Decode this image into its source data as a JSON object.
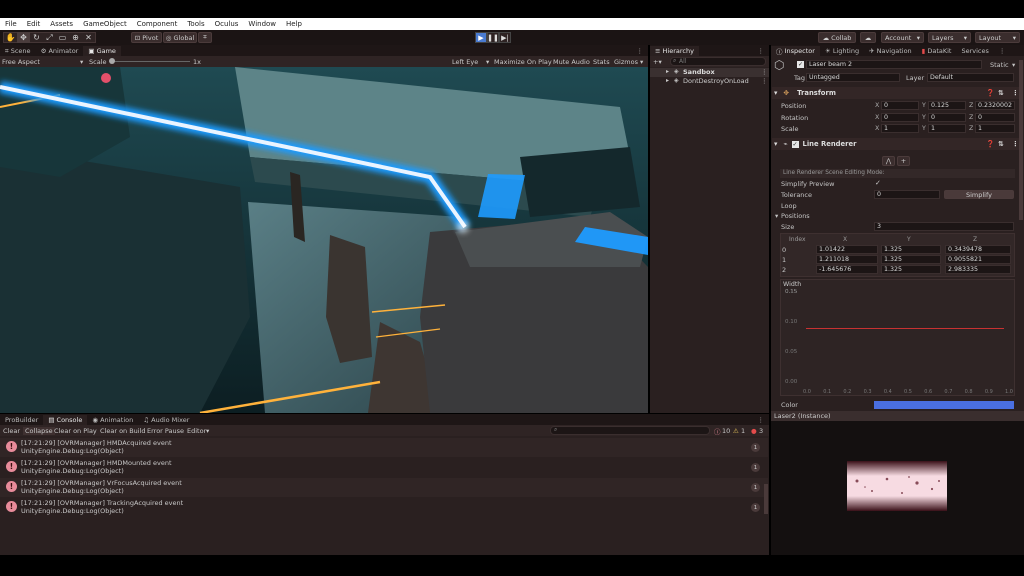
{
  "menu": [
    "File",
    "Edit",
    "Assets",
    "GameObject",
    "Component",
    "Tools",
    "Oculus",
    "Window",
    "Help"
  ],
  "toolbar": {
    "pivot": "Pivot",
    "global": "Global",
    "collab": "Collab",
    "account": "Account",
    "layers": "Layers",
    "layout": "Layout",
    "play_icon": "play-icon",
    "pause_icon": "pause-icon",
    "step_icon": "step-icon"
  },
  "scene_tabs": [
    "Scene",
    "Animator",
    "Game"
  ],
  "game_bar": {
    "aspect": "Free Aspect",
    "scale_label": "Scale",
    "scale_value": "1x",
    "eye": "Left Eye",
    "maximize": "Maximize On Play",
    "mute": "Mute Audio",
    "stats": "Stats",
    "gizmos": "Gizmos"
  },
  "hierarchy": {
    "tab": "Hierarchy",
    "search_placeholder": "All",
    "items": [
      "Sandbox",
      "DontDestroyOnLoad"
    ]
  },
  "inspector_tabs": [
    "Inspector",
    "Lighting",
    "Navigation",
    "DataKit",
    "Services"
  ],
  "inspector": {
    "object_name": "Laser beam 2",
    "static": "Static",
    "tag_label": "Tag",
    "tag": "Untagged",
    "layer_label": "Layer",
    "layer": "Default",
    "transform": {
      "title": "Transform",
      "position_label": "Position",
      "rotation_label": "Rotation",
      "scale_label": "Scale",
      "position": [
        "0",
        "0.125",
        "0.2320002"
      ],
      "rotation": [
        "0",
        "0",
        "0"
      ],
      "scale": [
        "1",
        "1",
        "1"
      ]
    },
    "line_renderer": {
      "title": "Line Renderer",
      "edit_mode": "Line Renderer Scene Editing Mode:",
      "simplify_preview": "Simplify Preview",
      "tolerance_label": "Tolerance",
      "tolerance": "0",
      "simplify_button": "Simplify",
      "loop": "Loop",
      "positions": "Positions",
      "size_label": "Size",
      "size": "3",
      "columns": [
        "Index",
        "X",
        "Y",
        "Z"
      ],
      "rows": [
        [
          "0",
          "1.01422",
          "1.325",
          "0.3439478"
        ],
        [
          "1",
          "1.211018",
          "1.325",
          "0.9055821"
        ],
        [
          "2",
          "-1.645676",
          "1.325",
          "2.983335"
        ]
      ],
      "width_label": "Width",
      "width_value": "0.15",
      "graph_y": [
        "0.15",
        "0.10",
        "0.05",
        "0.00"
      ],
      "graph_x": [
        "0.0",
        "0.1",
        "0.2",
        "0.3",
        "0.4",
        "0.5",
        "0.6",
        "0.7",
        "0.8",
        "0.9",
        "1.0"
      ],
      "color_label": "Color",
      "color": "#4a6fe0"
    },
    "material": "Laser2 (Instance)"
  },
  "bottom_tabs": [
    "ProBuilder",
    "Console",
    "Animation",
    "Audio Mixer"
  ],
  "console": {
    "buttons": [
      "Clear",
      "Collapse",
      "Clear on Play",
      "Clear on Build",
      "Error Pause",
      "Editor"
    ],
    "counts": [
      "10",
      "1",
      "3"
    ],
    "logs": [
      {
        "line1": "[17:21:29] [OVRManager] HMDAcquired event",
        "line2": "UnityEngine.Debug:Log(Object)",
        "count": "1"
      },
      {
        "line1": "[17:21:29] [OVRManager] HMDMounted event",
        "line2": "UnityEngine.Debug:Log(Object)",
        "count": "1"
      },
      {
        "line1": "[17:21:29] [OVRManager] VrFocusAcquired event",
        "line2": "UnityEngine.Debug:Log(Object)",
        "count": "1"
      },
      {
        "line1": "[17:21:29] [OVRManager] TrackingAcquired event",
        "line2": "UnityEngine.Debug:Log(Object)",
        "count": "1"
      }
    ]
  },
  "colors": {
    "accent_play": "#4a7bd1",
    "laser_white": "#eaf4ff",
    "laser_cyan": "#1e9bff",
    "laser_orange": "#ffb23b",
    "error": "#e88b9a"
  }
}
